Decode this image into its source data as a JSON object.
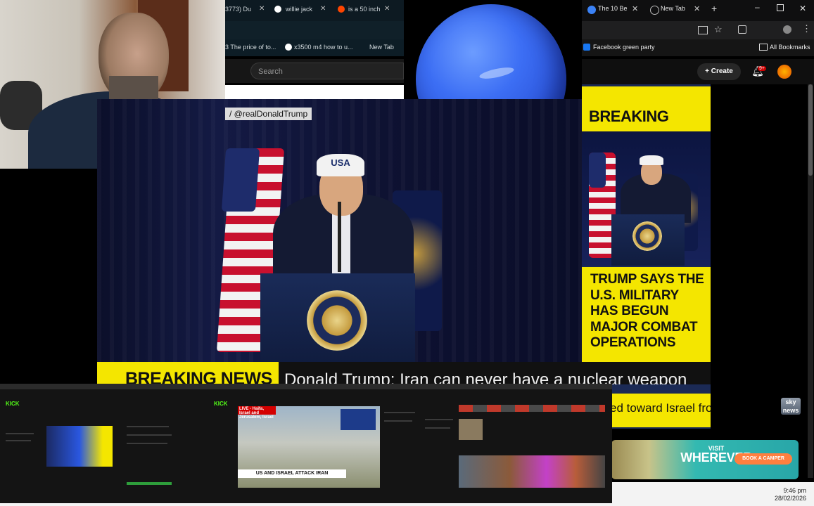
{
  "left_browser": {
    "tabs": [
      {
        "label": "3773) Du"
      },
      {
        "label": "willie jack"
      },
      {
        "label": "is a 50 inch"
      }
    ],
    "bookmarks": [
      {
        "label": "3 The price of to..."
      },
      {
        "label": "x3500 m4 how to u..."
      },
      {
        "label": "New Tab"
      }
    ],
    "search_placeholder": "Search"
  },
  "right_browser": {
    "tabs": [
      {
        "label": "The 10 Be"
      },
      {
        "label": "New Tab"
      }
    ],
    "bookmarks": [
      {
        "label": "Facebook green party"
      },
      {
        "label": "All Bookmarks"
      }
    ],
    "create_label": "Create",
    "notification_badge": "9+"
  },
  "video": {
    "handle": "/ @realDonaldTrump",
    "cap_text": "USA"
  },
  "news_panel": {
    "heading": "BREAKING NEWS",
    "lines": [
      "TRUMP SAYS THE",
      "U.S. MILITARY",
      "HAS BEGUN",
      "MAJOR COMBAT",
      "OPERATIONS"
    ]
  },
  "lower_third": {
    "label": "BREAKING NEWS",
    "headline": "Donald Trump: Iran can never have a nuclear weapon",
    "ticker": "ed toward Israel fro"
  },
  "sky_logo": "sky news",
  "ad": {
    "visit": "VISIT",
    "tagline": "WHEREVER",
    "button": "BOOK A CAMPER"
  },
  "nested": {
    "live_label": "LIVE - Haifa, Israel and Jerusalem, Israel",
    "attack_label": "US AND ISRAEL ATTACK IRAN",
    "kick_label": "KICK"
  },
  "taskbar": {
    "time": "9:46 pm",
    "date": "28/02/2026"
  },
  "colors": {
    "breaking_yellow": "#f4e600",
    "neptune_blue": "#3c6ef4",
    "podium_navy": "#1a2b58"
  }
}
